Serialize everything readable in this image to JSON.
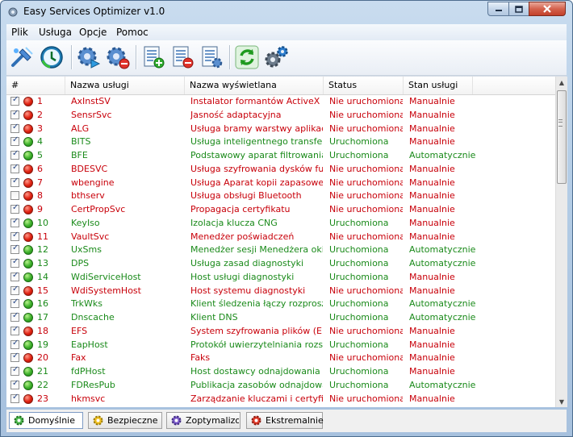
{
  "window": {
    "title": "Easy Services Optimizer v1.0"
  },
  "menu": [
    "Plik",
    "Usługa",
    "Opcje",
    "Pomoc"
  ],
  "columns": [
    "#",
    "Nazwa usługi",
    "Nazwa wyświetlana",
    "Status",
    "Stan usługi"
  ],
  "rows": [
    {
      "checked": true,
      "state": "red",
      "num": "1",
      "name": "AxInstSV",
      "display": "Instalator formantów ActiveX (...",
      "status": "Nie uruchomiona",
      "startup": "Manualnie"
    },
    {
      "checked": true,
      "state": "red",
      "num": "2",
      "name": "SensrSvc",
      "display": "Jasność adaptacyjna",
      "status": "Nie uruchomiona",
      "startup": "Manualnie"
    },
    {
      "checked": true,
      "state": "red",
      "num": "3",
      "name": "ALG",
      "display": "Usługa bramy warstwy aplikacji",
      "status": "Nie uruchomiona",
      "startup": "Manualnie"
    },
    {
      "checked": true,
      "state": "green",
      "num": "4",
      "name": "BITS",
      "display": "Usługa inteligentnego transfer...",
      "status": "Uruchomiona",
      "startup": "Manualnie"
    },
    {
      "checked": true,
      "state": "green",
      "num": "5",
      "name": "BFE",
      "display": "Podstawowy aparat filtrowania",
      "status": "Uruchomiona",
      "startup": "Automatycznie"
    },
    {
      "checked": true,
      "state": "red",
      "num": "6",
      "name": "BDESVC",
      "display": "Usługa szyfrowania dysków fu...",
      "status": "Nie uruchomiona",
      "startup": "Manualnie"
    },
    {
      "checked": true,
      "state": "red",
      "num": "7",
      "name": "wbengine",
      "display": "Usługa Aparat kopii zapasowej ...",
      "status": "Nie uruchomiona",
      "startup": "Manualnie"
    },
    {
      "checked": false,
      "state": "red",
      "num": "8",
      "name": "bthserv",
      "display": "Usługa obsługi Bluetooth",
      "status": "Nie uruchomiona",
      "startup": "Manualnie"
    },
    {
      "checked": true,
      "state": "red",
      "num": "9",
      "name": "CertPropSvc",
      "display": "Propagacja certyfikatu",
      "status": "Nie uruchomiona",
      "startup": "Manualnie"
    },
    {
      "checked": true,
      "state": "green",
      "num": "10",
      "name": "KeyIso",
      "display": "Izolacja klucza CNG",
      "status": "Uruchomiona",
      "startup": "Manualnie"
    },
    {
      "checked": true,
      "state": "red",
      "num": "11",
      "name": "VaultSvc",
      "display": "Menedżer poświadczeń",
      "status": "Nie uruchomiona",
      "startup": "Manualnie"
    },
    {
      "checked": true,
      "state": "green",
      "num": "12",
      "name": "UxSms",
      "display": "Menedżer sesji Menedżera okie...",
      "status": "Uruchomiona",
      "startup": "Automatycznie"
    },
    {
      "checked": true,
      "state": "green",
      "num": "13",
      "name": "DPS",
      "display": "Usługa zasad diagnostyki",
      "status": "Uruchomiona",
      "startup": "Automatycznie"
    },
    {
      "checked": true,
      "state": "green",
      "num": "14",
      "name": "WdiServiceHost",
      "display": "Host usługi diagnostyki",
      "status": "Uruchomiona",
      "startup": "Manualnie"
    },
    {
      "checked": true,
      "state": "red",
      "num": "15",
      "name": "WdiSystemHost",
      "display": "Host systemu diagnostyki",
      "status": "Nie uruchomiona",
      "startup": "Manualnie"
    },
    {
      "checked": true,
      "state": "green",
      "num": "16",
      "name": "TrkWks",
      "display": "Klient śledzenia łączy rozprosz...",
      "status": "Uruchomiona",
      "startup": "Automatycznie"
    },
    {
      "checked": true,
      "state": "green",
      "num": "17",
      "name": "Dnscache",
      "display": "Klient DNS",
      "status": "Uruchomiona",
      "startup": "Automatycznie"
    },
    {
      "checked": true,
      "state": "red",
      "num": "18",
      "name": "EFS",
      "display": "System szyfrowania plików (EFS)",
      "status": "Nie uruchomiona",
      "startup": "Manualnie"
    },
    {
      "checked": true,
      "state": "green",
      "num": "19",
      "name": "EapHost",
      "display": "Protokół uwierzytelniania rozsz...",
      "status": "Uruchomiona",
      "startup": "Manualnie"
    },
    {
      "checked": true,
      "state": "red",
      "num": "20",
      "name": "Fax",
      "display": "Faks",
      "status": "Nie uruchomiona",
      "startup": "Manualnie"
    },
    {
      "checked": true,
      "state": "green",
      "num": "21",
      "name": "fdPHost",
      "display": "Host dostawcy odnajdowania f...",
      "status": "Uruchomiona",
      "startup": "Manualnie"
    },
    {
      "checked": true,
      "state": "green",
      "num": "22",
      "name": "FDResPub",
      "display": "Publikacja zasobów odnajdowa...",
      "status": "Uruchomiona",
      "startup": "Automatycznie"
    },
    {
      "checked": true,
      "state": "red",
      "num": "23",
      "name": "hkmsvc",
      "display": "Zarządzanie kluczami i certyfika...",
      "status": "Nie uruchomiona",
      "startup": "Manualnie"
    }
  ],
  "tabs": [
    "Domyślnie",
    "Bezpieczne",
    "Zoptymalizow",
    "Ekstremalnie"
  ],
  "colors": {
    "stopped": "#c8000a",
    "running": "#1a8a1a",
    "selected_tab_border": "#7e9bc4"
  },
  "icons": {
    "toolbar": [
      "cleanup-tool-icon",
      "clock-refresh-icon",
      "gear-play-icon",
      "gear-stop-icon",
      "doc-add-icon",
      "doc-remove-icon",
      "doc-settings-icon",
      "refresh-icon",
      "settings-gears-icon"
    ],
    "tabs": [
      "gear-green-icon",
      "gear-yellow-icon",
      "gear-purple-icon",
      "gear-red-icon"
    ]
  }
}
